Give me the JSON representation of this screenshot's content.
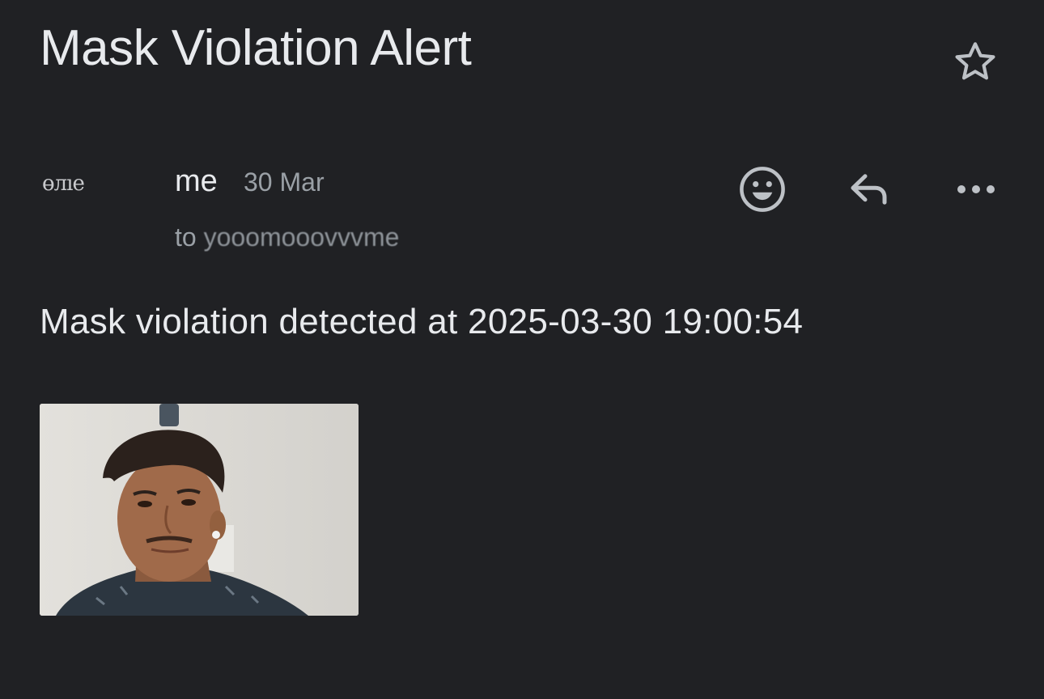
{
  "email": {
    "subject": "Mask Violation Alert",
    "sender": {
      "avatar_text": "ɵᴫıe",
      "name": "me",
      "date": "30 Mar",
      "to_prefix": "to",
      "to_address": "yooomooovvvme"
    },
    "body": "Mask violation detected at 2025-03-30 19:00:54",
    "attachment": {
      "kind": "photo"
    }
  },
  "icons": {
    "star": "star-outline-icon",
    "emoji": "emoji-react-icon",
    "reply": "reply-icon",
    "more": "more-horizontal-icon"
  },
  "colors": {
    "background": "#202124",
    "text_primary": "#e8eaed",
    "text_secondary": "#9aa0a6",
    "icon": "#bdc1c6"
  }
}
